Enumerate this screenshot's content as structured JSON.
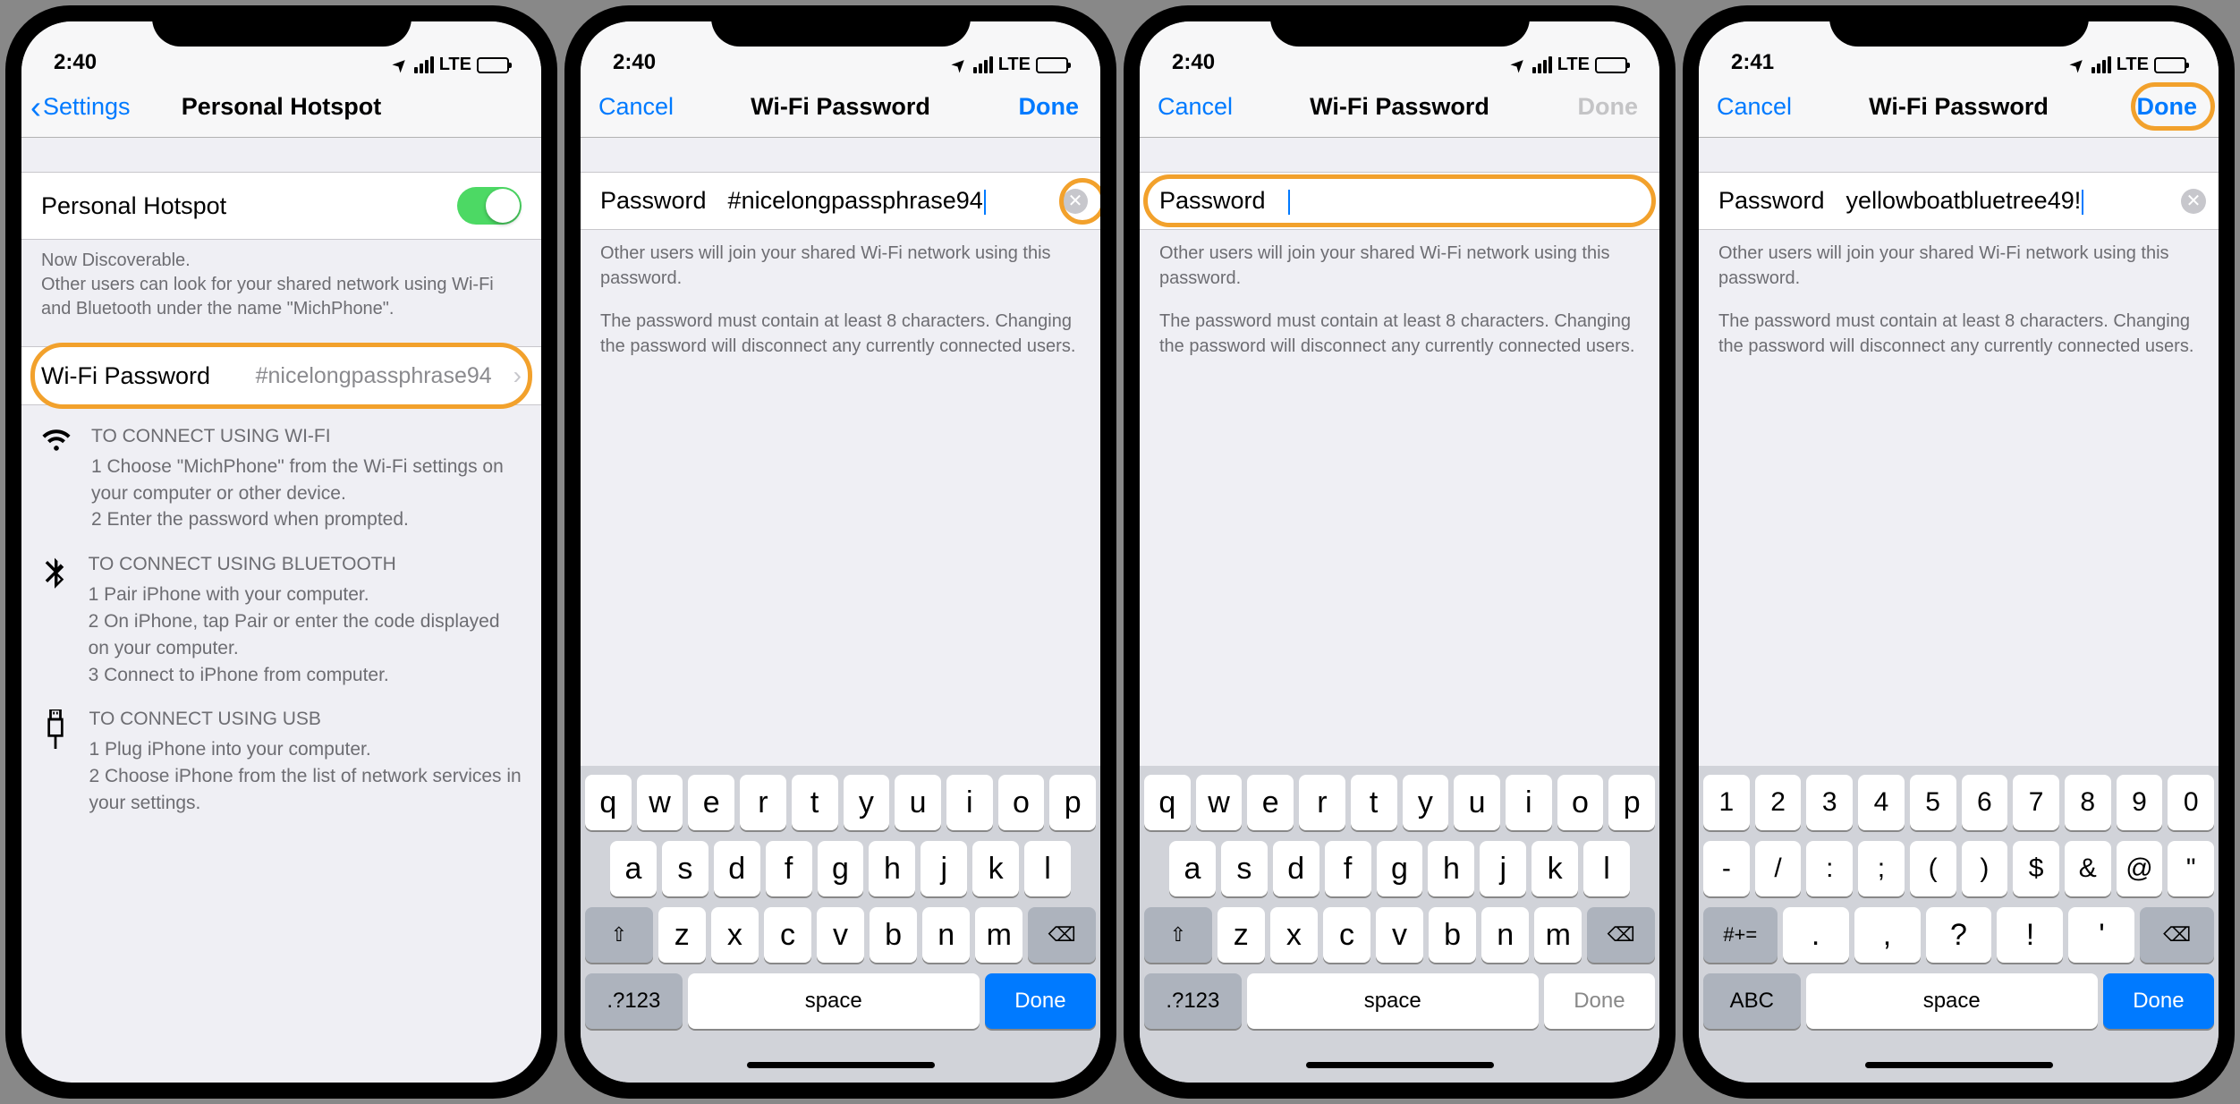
{
  "status": {
    "time1": "2:40",
    "time2": "2:40",
    "time3": "2:40",
    "time4": "2:41",
    "carrier": "LTE"
  },
  "s1": {
    "back_label": "Settings",
    "title": "Personal Hotspot",
    "toggle_label": "Personal Hotspot",
    "discoverable": "Now Discoverable.",
    "discoverable_sub": "Other users can look for your shared network using Wi-Fi and Bluetooth under the name \"MichPhone\".",
    "pwd_label": "Wi-Fi Password",
    "pwd_value": "#nicelongpassphrase94",
    "wifi_head": "TO CONNECT USING WI-FI",
    "wifi_1": "1 Choose \"MichPhone\" from the Wi-Fi settings on your computer or other device.",
    "wifi_2": "2 Enter the password when prompted.",
    "bt_head": "TO CONNECT USING BLUETOOTH",
    "bt_1": "1 Pair iPhone with your computer.",
    "bt_2": "2 On iPhone, tap Pair or enter the code displayed on your computer.",
    "bt_3": "3 Connect to iPhone from computer.",
    "usb_head": "TO CONNECT USING USB",
    "usb_1": "1 Plug iPhone into your computer.",
    "usb_2": "2 Choose iPhone from the list of network services in your settings."
  },
  "pwd_screen": {
    "cancel": "Cancel",
    "title": "Wi-Fi Password",
    "done": "Done",
    "field_label": "Password",
    "help1": "Other users will join your shared Wi-Fi network using this password.",
    "help2": "The password must contain at least 8 characters. Changing the password will disconnect any currently connected users."
  },
  "s2": {
    "value": "#nicelongpassphrase94"
  },
  "s3": {
    "value": ""
  },
  "s4": {
    "value": "yellowboatbluetree49!"
  },
  "kb": {
    "r1": [
      "q",
      "w",
      "e",
      "r",
      "t",
      "y",
      "u",
      "i",
      "o",
      "p"
    ],
    "r2": [
      "a",
      "s",
      "d",
      "f",
      "g",
      "h",
      "j",
      "k",
      "l"
    ],
    "r3": [
      "z",
      "x",
      "c",
      "v",
      "b",
      "n",
      "m"
    ],
    "n1": [
      "1",
      "2",
      "3",
      "4",
      "5",
      "6",
      "7",
      "8",
      "9",
      "0"
    ],
    "n2": [
      "-",
      "/",
      ":",
      ";",
      "(",
      ")",
      "$",
      "&",
      "@",
      "\""
    ],
    "n3": [
      ".",
      ",",
      "?",
      "!",
      "'"
    ],
    "mode_num": ".?123",
    "mode_abc": "ABC",
    "mode_sym": "#+=",
    "space": "space",
    "done": "Done"
  }
}
